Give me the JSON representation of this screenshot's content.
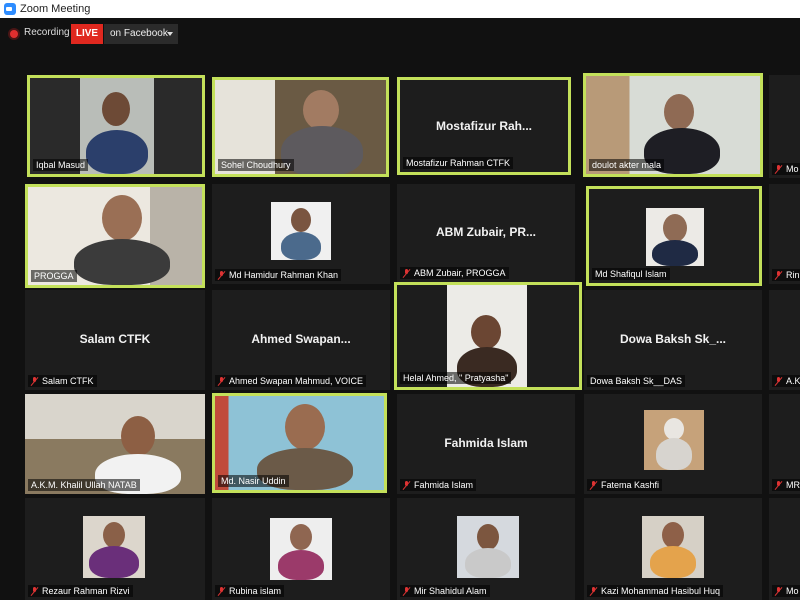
{
  "window": {
    "title": "Zoom Meeting"
  },
  "topbar": {
    "recording_label": "Recording",
    "live_label": "LIVE",
    "stream_target": "on Facebook"
  },
  "participants": [
    {
      "name": "Iqbal Masud",
      "muted": false,
      "active": true
    },
    {
      "name": "Sohel Choudhury",
      "muted": false,
      "active": true
    },
    {
      "name": "Mostafizur Rahman CTFK",
      "display": "Mostafizur  Rah...",
      "muted": false,
      "active": true
    },
    {
      "name": "doulot akter mala",
      "muted": false,
      "active": true
    },
    {
      "name": "Mo",
      "muted": true,
      "active": false
    },
    {
      "name": "PROGGA",
      "muted": false,
      "active": true
    },
    {
      "name": "Md Hamidur Rahman Khan",
      "muted": true,
      "active": false
    },
    {
      "name": "ABM Zubair, PROGGA",
      "display": "ABM  Zubair,  PR...",
      "muted": true,
      "active": false
    },
    {
      "name": "Md Shafiqul Islam",
      "muted": false,
      "active": true
    },
    {
      "name": "Rin",
      "muted": true,
      "active": false
    },
    {
      "name": "Salam CTFK",
      "display": "Salam CTFK",
      "muted": true,
      "active": false
    },
    {
      "name": "Ahmed Swapan Mahmud, VOICE",
      "display": "Ahmed  Swapan...",
      "muted": true,
      "active": false
    },
    {
      "name": "Helal  Ahmed, \" Pratyasha\"",
      "muted": false,
      "active": true
    },
    {
      "name": "Dowa Baksh Sk__DAS",
      "display": "Dowa  Baksh  Sk_...",
      "muted": false,
      "active": false
    },
    {
      "name": "A.K",
      "muted": true,
      "active": false
    },
    {
      "name": "A.K.M. Khalil Ullah NATAB",
      "muted": false,
      "active": false
    },
    {
      "name": "Md. Nasir Uddin",
      "muted": false,
      "active": true
    },
    {
      "name": "Fahmida Islam",
      "display": "Fahmida Islam",
      "muted": true,
      "active": false
    },
    {
      "name": "Fatema Kashfi",
      "muted": true,
      "active": false
    },
    {
      "name": "MR",
      "muted": true,
      "active": false
    },
    {
      "name": "Rezaur Rahman Rizvi",
      "muted": true,
      "active": false
    },
    {
      "name": "Rubina islam",
      "muted": true,
      "active": false
    },
    {
      "name": "Mir Shahidul Alam",
      "muted": true,
      "active": false
    },
    {
      "name": "Kazi Mohammad Hasibul Huq",
      "muted": true,
      "active": false
    },
    {
      "name": "Mo",
      "muted": true,
      "active": false
    }
  ]
}
